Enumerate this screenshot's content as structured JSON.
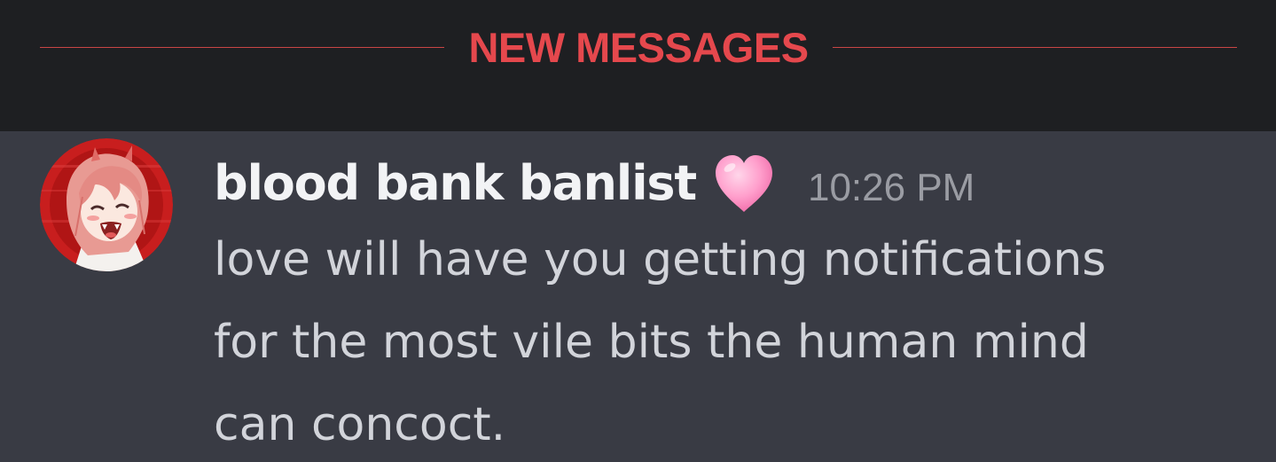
{
  "divider": {
    "label": "NEW MESSAGES",
    "color": "#e5484d"
  },
  "message": {
    "author": "blood bank banlist",
    "author_badge_icon": "pink-heart-emoji",
    "timestamp": "10:26 PM",
    "content_lines": [
      "love will have you getting notifications",
      "for the most vile bits the human mind",
      "can concoct."
    ]
  },
  "colors": {
    "background_dark": "#1e1f22",
    "message_highlight": "#393b44",
    "username": "#f2f3f5",
    "timestamp": "#9a9ca3",
    "body_text": "#d2d4da"
  }
}
